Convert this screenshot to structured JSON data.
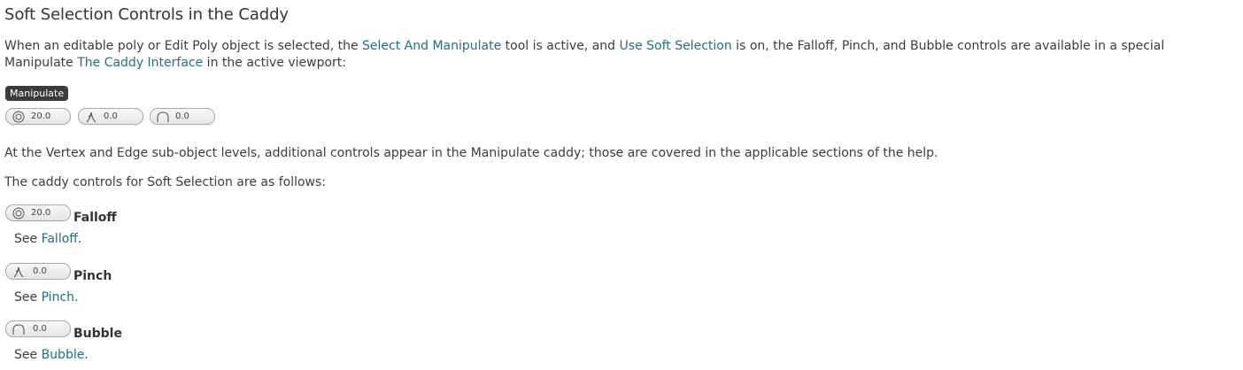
{
  "heading": "Soft Selection Controls in the Caddy",
  "intro": {
    "t1": "When an editable poly or Edit Poly object is selected, the ",
    "link1": "Select And Manipulate",
    "t2": " tool is active, and ",
    "link2": "Use Soft Selection",
    "t3": " is on, the Falloff, Pinch, and Bubble controls are available in a special Manipulate ",
    "link3": "The Caddy Interface",
    "t4": " in the active viewport:"
  },
  "caddy": {
    "badge": "Manipulate",
    "controls": [
      {
        "icon": "falloff-icon",
        "value": "20.0"
      },
      {
        "icon": "pinch-icon",
        "value": "0.0"
      },
      {
        "icon": "bubble-icon",
        "value": "0.0"
      }
    ]
  },
  "para2": "At the Vertex and Edge sub-object levels, additional controls appear in the Manipulate caddy; those are covered in the applicable sections of the help.",
  "para3": "The caddy controls for Soft Selection are as follows:",
  "items": [
    {
      "icon": "falloff-icon",
      "value": "20.0",
      "term": "Falloff",
      "see_prefix": "See ",
      "see_link": "Falloff",
      "see_suffix": "."
    },
    {
      "icon": "pinch-icon",
      "value": "0.0",
      "term": "Pinch",
      "see_prefix": "See ",
      "see_link": "Pinch",
      "see_suffix": "."
    },
    {
      "icon": "bubble-icon",
      "value": "0.0",
      "term": "Bubble",
      "see_prefix": "See ",
      "see_link": "Bubble",
      "see_suffix": "."
    }
  ],
  "colors": {
    "link": "#1f6f8b",
    "text": "#3c3c3c",
    "badge_bg": "#3b3b3b"
  }
}
